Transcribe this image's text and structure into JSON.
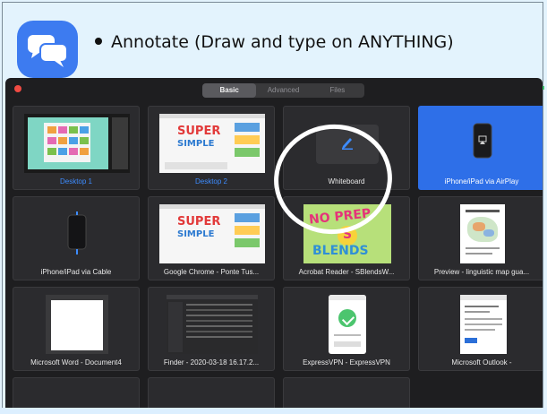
{
  "slide": {
    "bullet": "Annotate (Draw and type on ANYTHING)",
    "icon": "chat-bubbles-icon",
    "icon_color": "#3d7bf0"
  },
  "window": {
    "tabs": [
      {
        "label": "Basic",
        "active": true
      },
      {
        "label": "Advanced",
        "active": false
      },
      {
        "label": "Files",
        "active": false
      }
    ],
    "tiles": [
      {
        "label": "Desktop 1",
        "style": "blue"
      },
      {
        "label": "Desktop 2",
        "style": "blue"
      },
      {
        "label": "Whiteboard",
        "style": "normal"
      },
      {
        "label": "iPhone/iPad via AirPlay",
        "style": "selected"
      },
      {
        "label": "iPhone/iPad via Cable",
        "style": "normal"
      },
      {
        "label": "Google Chrome - Ponte Tus...",
        "style": "normal"
      },
      {
        "label": "Acrobat Reader - SBlendsW...",
        "style": "normal"
      },
      {
        "label": "Preview - linguistic map gua...",
        "style": "normal"
      },
      {
        "label": "Microsoft Word - Document4",
        "style": "normal"
      },
      {
        "label": "Finder - 2020-03-18 16.17.2...",
        "style": "normal"
      },
      {
        "label": "ExpressVPN - ExpressVPN",
        "style": "normal"
      },
      {
        "label": "Microsoft Outlook -",
        "style": "normal"
      }
    ]
  },
  "colors": {
    "accent_blue": "#2e6fe8",
    "window_bg": "#1e1e20",
    "slide_bg": "#e3f3fd"
  }
}
